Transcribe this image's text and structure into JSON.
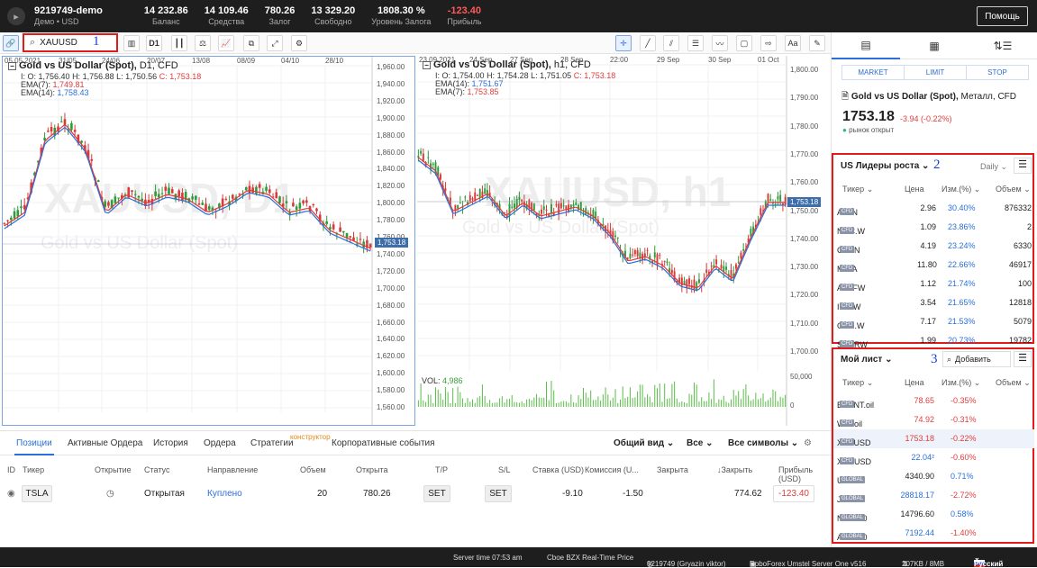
{
  "topbar": {
    "account": "9219749-demo",
    "account_sub": "Демо • USD",
    "stats": [
      {
        "value": "14 232.86",
        "label": "Баланс"
      },
      {
        "value": "14 109.46",
        "label": "Средства"
      },
      {
        "value": "780.26",
        "label": "Залог"
      },
      {
        "value": "13 329.20",
        "label": "Свободно"
      },
      {
        "value": "1808.30 %",
        "label": "Уровень Залога"
      },
      {
        "value": "-123.40",
        "label": "Прибыль"
      }
    ],
    "help": "Помощь"
  },
  "toolbar": {
    "search_value": "XAUUSD",
    "timeframe": "D1",
    "font_btn": "Aa"
  },
  "annotations": [
    "1",
    "2",
    "3"
  ],
  "chart1": {
    "title": "Gold vs US Dollar (Spot),",
    "tf": "D1,",
    "kind": "CFD",
    "ohlc_o": "I: O: 1,756.40",
    "ohlc_h": "H: 1,756.88",
    "ohlc_l": "L: 1,750.56",
    "ohlc_c": "C: 1,753.18",
    "ema1_label": "EMA(7):",
    "ema1_val": "1,749.81",
    "ema2_label": "EMA(14):",
    "ema2_val": "1,758.43",
    "wm1": "XAUUSD, D1",
    "wm2": "Gold vs US Dollar (Spot)",
    "price_tag": "1,753.18",
    "y_ticks": [
      "1,960.00",
      "1,940.00",
      "1,920.00",
      "1,900.00",
      "1,880.00",
      "1,860.00",
      "1,840.00",
      "1,820.00",
      "1,800.00",
      "1,780.00",
      "1,760.00",
      "1,740.00",
      "1,720.00",
      "1,700.00",
      "1,680.00",
      "1,660.00",
      "1,640.00",
      "1,620.00",
      "1,600.00",
      "1,580.00",
      "1,560.00"
    ],
    "x_ticks": [
      "05.05.2021",
      "31/05",
      "24/06",
      "20/07",
      "13/08",
      "08/09",
      "04/10",
      "28/10"
    ]
  },
  "chart2": {
    "title": "Gold vs US Dollar (Spot),",
    "tf": "h1,",
    "kind": "CFD",
    "ohlc_o": "I: O: 1,754.00",
    "ohlc_h": "H: 1,754.28",
    "ohlc_l": "L: 1,751.05",
    "ohlc_c": "C: 1,753.18",
    "ema1_label": "EMA(14):",
    "ema1_val": "1,751.67",
    "ema2_label": "EMA(7):",
    "ema2_val": "1,753.85",
    "wm1": "XAUUSD, h1",
    "wm2": "Gold vs US Dollar (Spot)",
    "price_tag": "1,753.18",
    "y_ticks": [
      "1,800.00",
      "1,790.00",
      "1,780.00",
      "1,770.00",
      "1,760.00",
      "1,750.00",
      "1,740.00",
      "1,730.00",
      "1,720.00",
      "1,710.00",
      "1,700.00"
    ],
    "x_ticks": [
      "23.09.2021",
      "24 Sep",
      "27 Sep",
      "28 Sep",
      "22:00",
      "29 Sep",
      "30 Sep",
      "01 Oct"
    ],
    "vol_label": "VOL:",
    "vol_val": "4,986",
    "vol_ticks": [
      "50,000",
      "0"
    ]
  },
  "bottom": {
    "tabs": [
      "Позиции",
      "Активные Ордера",
      "История",
      "Ордера",
      "Стратегии",
      "Корпоративные события"
    ],
    "konstruktor": "конструктор",
    "view": "Общий вид",
    "all": "Все",
    "all_symbols": "Все символы",
    "headers": [
      "ID",
      "Тикер",
      "Открытие",
      "Статус",
      "Направление",
      "Объем",
      "Открыта",
      "T/P",
      "S/L",
      "Ставка (USD)",
      "Комиссия (U...",
      "Закрыта",
      "↓Закрыть",
      "Прибыль (USD)"
    ],
    "row": {
      "ticker": "TSLA",
      "status": "Открытая",
      "direction": "Куплено",
      "volume": "20",
      "open": "780.26",
      "tp": "SET",
      "sl": "SET",
      "rate": "-9.10",
      "commission": "-1.50",
      "close": "774.62",
      "profit": "-123.40"
    }
  },
  "right": {
    "order_types": [
      "MARKET",
      "LIMIT",
      "STOP"
    ],
    "instrument": "Gold vs US Dollar (Spot),",
    "instrument_sub": "Металл, CFD",
    "price": "1753.18",
    "change": "-3.94 (-0.22%)",
    "market_status": "рынок открыт",
    "leaders": {
      "title": "US Лидеры роста",
      "period": "Daily",
      "headers": [
        "Тикер",
        "Цена",
        "Изм.(%)",
        "Объем"
      ],
      "rows": [
        {
          "t": "ALZN",
          "p": "2.96",
          "c": "30.40%",
          "v": "876332"
        },
        {
          "t": "NGC.W",
          "p": "1.09",
          "c": "23.86%",
          "v": "2"
        },
        {
          "t": "CRKN",
          "p": "4.19",
          "c": "23.24%",
          "v": "6330"
        },
        {
          "t": "MDIA",
          "p": "11.80",
          "c": "22.66%",
          "v": "46917"
        },
        {
          "t": "ATNFW",
          "p": "1.12",
          "c": "21.74%",
          "v": "100"
        },
        {
          "t": "INDIW",
          "p": "3.54",
          "c": "21.65%",
          "v": "12818"
        },
        {
          "t": "GEN.W",
          "p": "7.17",
          "c": "21.53%",
          "v": "5079"
        },
        {
          "t": "SHCRW",
          "p": "1.99",
          "c": "20.73%",
          "v": "19782"
        }
      ]
    },
    "mylist": {
      "title": "Мой лист",
      "add": "Добавить",
      "headers": [
        "Тикер",
        "Цена",
        "Изм.(%)",
        "Объем"
      ],
      "rows": [
        {
          "t": "BRENT.oil",
          "b": "CFD",
          "p": "78.65",
          "c": "-0.35%",
          "pc": "neg",
          "cc": "neg"
        },
        {
          "t": "WTI.oil",
          "b": "CFD",
          "p": "74.92",
          "c": "-0.31%",
          "pc": "neg",
          "cc": "neg"
        },
        {
          "t": "XAUUSD",
          "b": "CFD",
          "p": "1753.18",
          "c": "-0.22%",
          "pc": "neg",
          "cc": "neg"
        },
        {
          "t": "XAGUSD",
          "b": "CFD",
          "p": "22.04²",
          "c": "-0.60%",
          "pc": "pos",
          "cc": "neg"
        },
        {
          "t": "US500",
          "b": "GLOBAL",
          "p": "4340.90",
          "c": "0.71%",
          "pc": "",
          "cc": "pos"
        },
        {
          "t": "JPY225",
          "b": "GLOBAL",
          "p": "28818.17",
          "c": "-2.72%",
          "pc": "pos",
          "cc": "neg"
        },
        {
          "t": "NAS100",
          "b": "GLOBAL",
          "p": "14796.60",
          "c": "0.58%",
          "pc": "",
          "cc": "pos"
        },
        {
          "t": "AUS200",
          "b": "GLOBAL",
          "p": "7192.44",
          "c": "-1.40%",
          "pc": "pos",
          "cc": "neg"
        }
      ]
    }
  },
  "status": {
    "server_time": "Server time 07:53 am",
    "feed": "Cboe BZX Real-Time Price",
    "user": "9219749 (Gryazin viktor)",
    "server": "RoboForex Umstel Server One v516",
    "traffic": "207KB / 8MB",
    "lang": "Русский"
  }
}
